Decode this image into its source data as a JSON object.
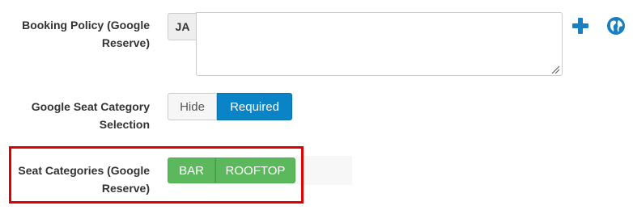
{
  "booking_policy": {
    "label": "Booking Policy (Google Reserve)",
    "language": "JA",
    "value": "",
    "add_icon": "plus-icon",
    "translate_icon": "globe-icon"
  },
  "seat_category_selection": {
    "label": "Google Seat Category Selection",
    "options": [
      "Hide",
      "Required"
    ],
    "selected": "Required"
  },
  "seat_categories": {
    "label": "Seat Categories (Google Reserve)",
    "items": [
      "BAR",
      "ROOFTOP"
    ]
  },
  "colors": {
    "primary": "#0a84c6",
    "success": "#5cb85c",
    "highlight": "#e00000",
    "icon_blue": "#1a7fc1"
  }
}
